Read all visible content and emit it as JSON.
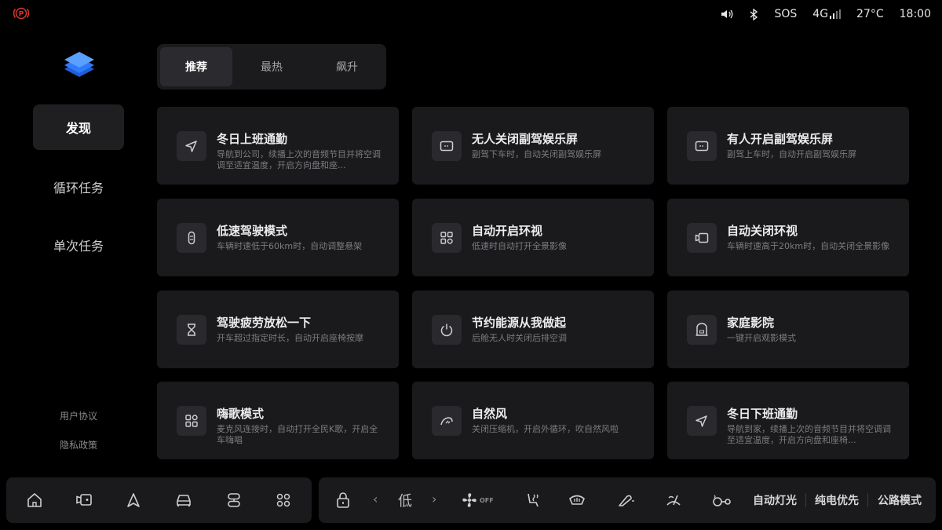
{
  "status": {
    "left_icon": "parking-brake-icon",
    "sos": "SOS",
    "network": "4G",
    "temperature": "27°C",
    "time": "18:00"
  },
  "sidebar": {
    "items": [
      {
        "label": "发现",
        "active": true
      },
      {
        "label": "循环任务",
        "active": false
      },
      {
        "label": "单次任务",
        "active": false
      }
    ],
    "links": [
      "用户协议",
      "隐私政策"
    ]
  },
  "tabs": [
    {
      "label": "推荐",
      "active": true
    },
    {
      "label": "最热",
      "active": false
    },
    {
      "label": "飙升",
      "active": false
    }
  ],
  "cards": [
    {
      "title": "冬日上班通勤",
      "desc": "导航到公司，续播上次的音频节目并将空调调至适宜温度，开启方向盘和座...",
      "icon": "navigation-icon"
    },
    {
      "title": "无人关闭副驾娱乐屏",
      "desc": "副驾下车时，自动关闭副驾娱乐屏",
      "icon": "screen-icon"
    },
    {
      "title": "有人开启副驾娱乐屏",
      "desc": "副驾上车时，自动开启副驾娱乐屏",
      "icon": "screen-icon"
    },
    {
      "title": "低速驾驶模式",
      "desc": "车辆时速低于60km时，自动调整悬架",
      "icon": "suspension-icon"
    },
    {
      "title": "自动开启环视",
      "desc": "低速时自动打开全景影像",
      "icon": "grid-icon"
    },
    {
      "title": "自动关闭环视",
      "desc": "车辆时速高于20km时，自动关闭全景影像",
      "icon": "camera-icon"
    },
    {
      "title": "驾驶疲劳放松一下",
      "desc": "开车超过指定时长，自动开启座椅按摩",
      "icon": "hourglass-icon"
    },
    {
      "title": "节约能源从我做起",
      "desc": "后舱无人时关闭后排空调",
      "icon": "power-icon"
    },
    {
      "title": "家庭影院",
      "desc": "一键开启观影模式",
      "icon": "theater-icon"
    },
    {
      "title": "嗨歌模式",
      "desc": "麦克风连接时，自动打开全民K歌，开启全车嗨唱",
      "icon": "grid-icon"
    },
    {
      "title": "自然风",
      "desc": "关闭压缩机，开启外循环，吹自然风啦",
      "icon": "wind-icon"
    },
    {
      "title": "冬日下班通勤",
      "desc": "导航到家，续播上次的音频节目并将空调调至适宜温度，开启方向盘和座椅...",
      "icon": "navigation-icon"
    }
  ],
  "dock_left": {
    "icons": [
      "home-icon",
      "camera-view-icon",
      "navigation-arrow-icon",
      "car-icon",
      "link-icon",
      "apps-grid-icon"
    ]
  },
  "dock_right": {
    "fan_level": "低",
    "fan_state": "OFF",
    "text_buttons": [
      "自动灯光",
      "纯电优先",
      "公路模式"
    ]
  },
  "colors": {
    "background": "#000000",
    "card": "#1a1a1d",
    "accent_red": "#d9362b",
    "logo_blue": "#2f7bff"
  }
}
